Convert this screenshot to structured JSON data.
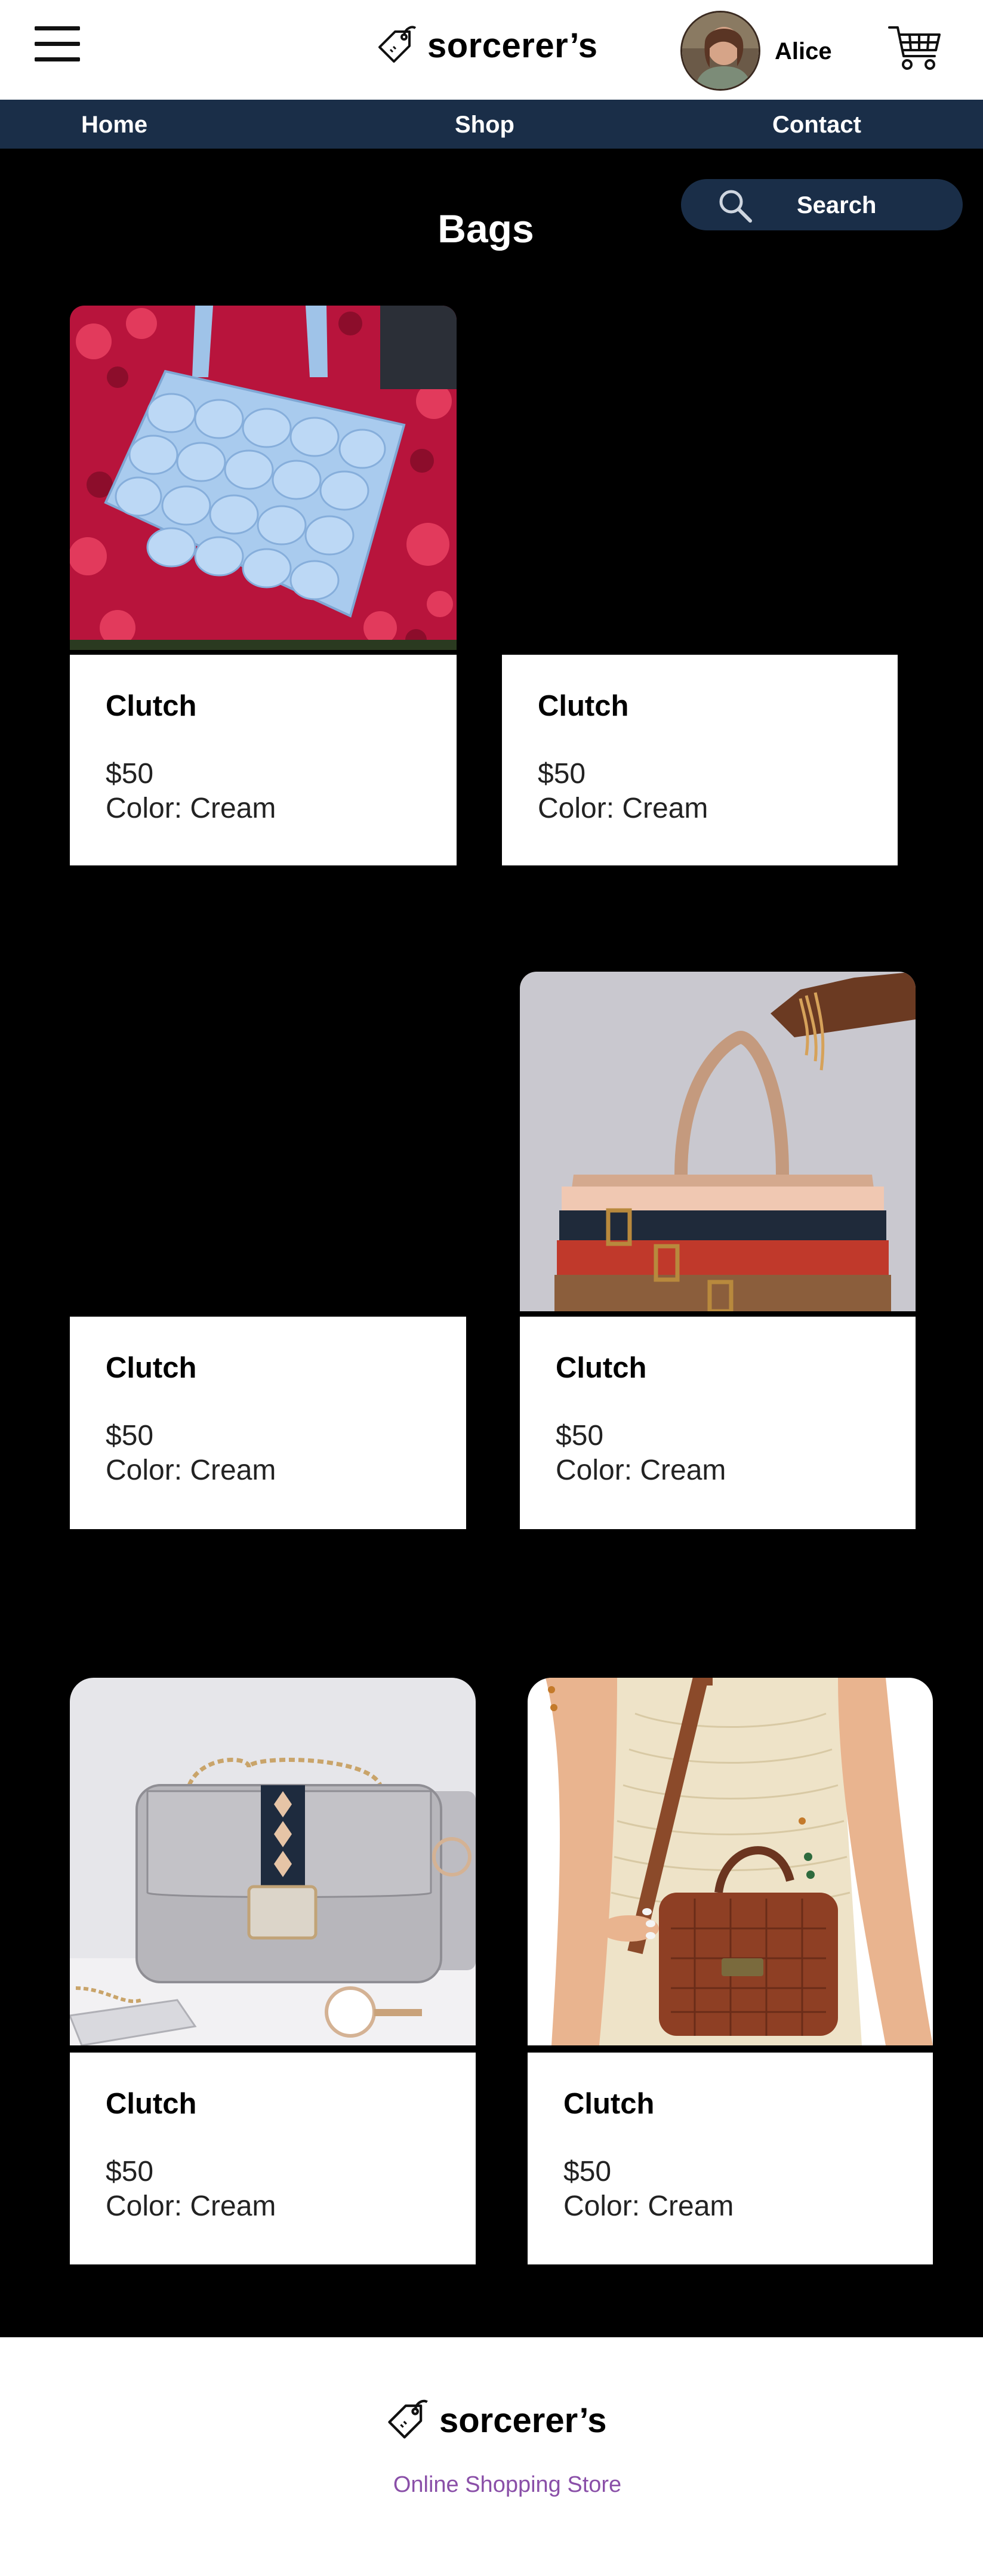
{
  "header": {
    "brand": "sorcerer’s",
    "user_name": "Alice"
  },
  "nav": {
    "home": "Home",
    "shop": "Shop",
    "contact": "Contact"
  },
  "search": {
    "label": "Search"
  },
  "page_title": "Bags",
  "products": [
    {
      "name": "Clutch",
      "price": "$50",
      "color": "Color: Cream"
    },
    {
      "name": "Clutch",
      "price": "$50",
      "color": "Color: Cream"
    },
    {
      "name": "Clutch",
      "price": "$50",
      "color": "Color: Cream"
    },
    {
      "name": "Clutch",
      "price": "$50",
      "color": "Color: Cream"
    },
    {
      "name": "Clutch",
      "price": "$50",
      "color": "Color: Cream"
    },
    {
      "name": "Clutch",
      "price": "$50",
      "color": "Color: Cream"
    }
  ],
  "footer": {
    "brand": "sorcerer’s",
    "tagline": "Online Shopping Store"
  },
  "colors": {
    "nav_background": "#1a2e48",
    "page_background": "#000000",
    "tagline": "#8a4fa8"
  },
  "icons": [
    "menu-icon",
    "price-tag-icon",
    "shopping-cart-icon",
    "search-icon"
  ]
}
